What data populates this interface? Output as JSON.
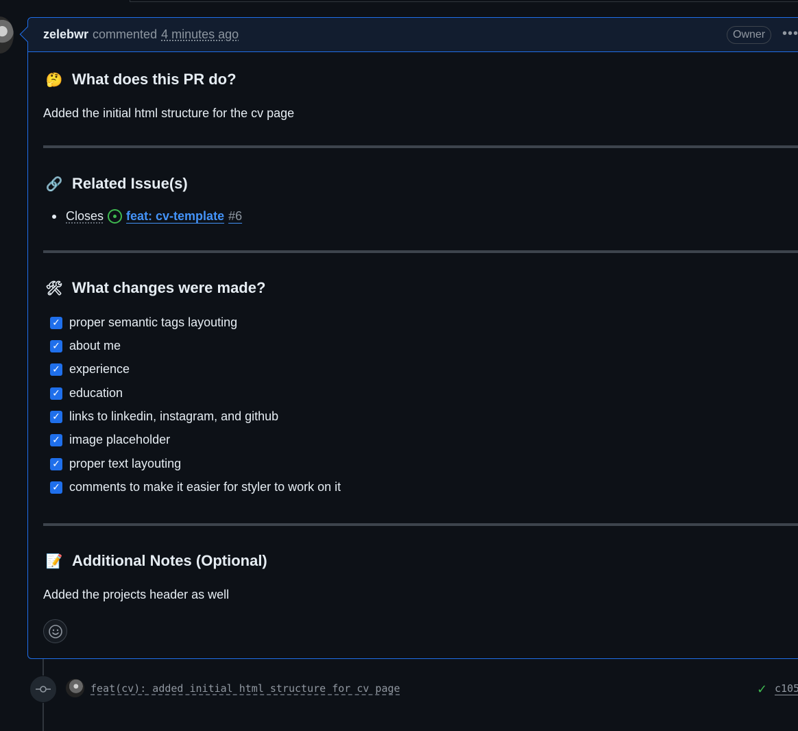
{
  "comment": {
    "author": "zelebwr",
    "verb": "commented",
    "timestamp": "4 minutes ago",
    "badge": "Owner",
    "menu_icon": "kebab-horizontal-icon"
  },
  "sections": {
    "what": {
      "emoji": "🤔",
      "title": "What does this PR do?",
      "text": "Added the initial html structure for the cv page"
    },
    "related": {
      "emoji": "🔗",
      "title": "Related Issue(s)",
      "closes_label": "Closes",
      "issue_title": "feat: cv-template",
      "issue_number": "#6"
    },
    "changes": {
      "emoji": "🛠",
      "title": "What changes were made?",
      "tasks": [
        "proper semantic tags layouting",
        "about me",
        "experience",
        "education",
        "links to linkedin, instagram, and github",
        "image placeholder",
        "proper text layouting",
        "comments to make it easier for styler to work on it"
      ]
    },
    "notes": {
      "emoji": "📝",
      "title": "Additional Notes (Optional)",
      "text": "Added the projects header as well"
    }
  },
  "commit": {
    "message": "feat(cv): added initial html structure for cv page",
    "sha": "c105"
  }
}
